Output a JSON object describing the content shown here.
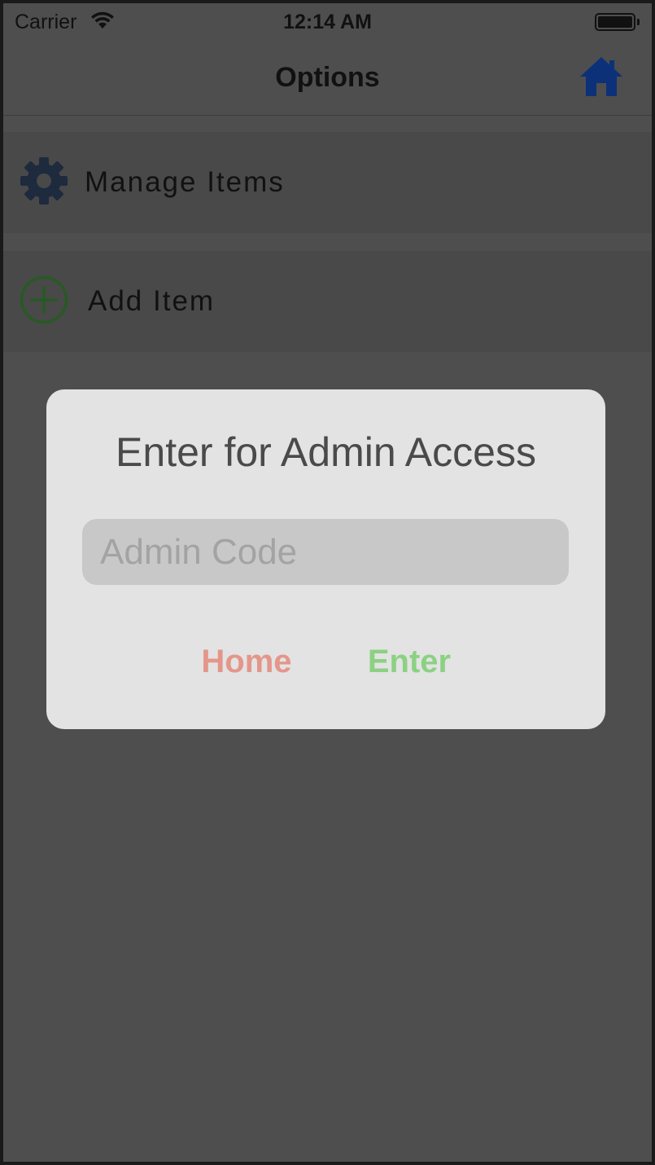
{
  "status_bar": {
    "carrier": "Carrier",
    "time": "12:14 AM"
  },
  "nav": {
    "title": "Options",
    "home_icon": "home-icon",
    "home_icon_color": "#0d3178"
  },
  "menu": {
    "items": [
      {
        "label": "Manage Items",
        "icon": "gear-icon",
        "icon_color": "#1e2a3d"
      },
      {
        "label": "Add Item",
        "icon": "plus-circle-icon",
        "icon_color": "#275a23"
      }
    ]
  },
  "dialog": {
    "title": "Enter for Admin Access",
    "input_placeholder": "Admin Code",
    "input_value": "",
    "home_label": "Home",
    "enter_label": "Enter",
    "home_color": "#e4968a",
    "enter_color": "#8cd183"
  }
}
